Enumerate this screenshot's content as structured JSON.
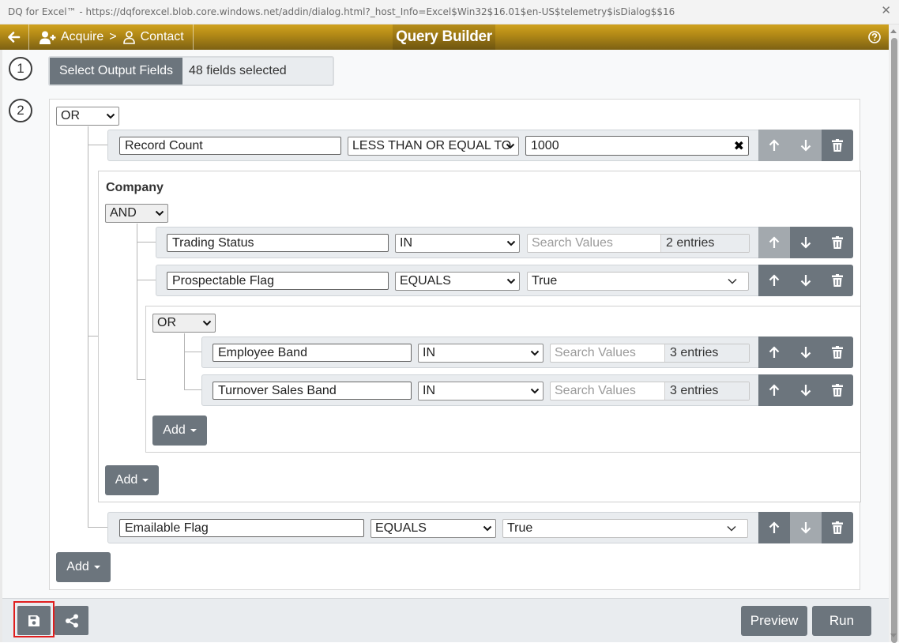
{
  "window": {
    "title": "DQ for Excel™ - https://dqforexcel.blob.core.windows.net/addin/dialog.html?_host_Info=Excel$Win32$16.01$en-US$telemetry$isDialog$$16",
    "close_glyph": "✕"
  },
  "header": {
    "crumb_acquire": "Acquire",
    "crumb_separator": ">",
    "crumb_contact": "Contact",
    "title": "Query Builder"
  },
  "steps": {
    "one": "1",
    "two": "2"
  },
  "output_fields": {
    "button_label": "Select Output Fields",
    "value": "48 fields selected"
  },
  "root": {
    "operator": "OR",
    "rule1": {
      "field": "Record Count",
      "comparator": "LESS THAN OR EQUAL TO",
      "value": "1000",
      "clear_glyph": "✖"
    },
    "company": {
      "label": "Company",
      "operator": "AND",
      "rule1": {
        "field": "Trading Status",
        "comparator": "IN",
        "placeholder": "Search Values",
        "entries": "2 entries"
      },
      "rule2": {
        "field": "Prospectable Flag",
        "comparator": "EQUALS",
        "value": "True"
      },
      "sub": {
        "operator": "OR",
        "rule1": {
          "field": "Employee Band",
          "comparator": "IN",
          "placeholder": "Search Values",
          "entries": "3 entries"
        },
        "rule2": {
          "field": "Turnover Sales Band",
          "comparator": "IN",
          "placeholder": "Search Values",
          "entries": "3 entries"
        },
        "add_label": "Add"
      },
      "add_label": "Add"
    },
    "rule_last": {
      "field": "Emailable Flag",
      "comparator": "EQUALS",
      "value": "True"
    },
    "add_label": "Add"
  },
  "footer": {
    "preview_label": "Preview",
    "run_label": "Run"
  },
  "icons": [
    "arrow-left-icon",
    "user-plus-icon",
    "user-icon",
    "help-circle-icon",
    "arrow-up-icon",
    "arrow-down-icon",
    "trash-icon",
    "save-icon",
    "share-icon",
    "chevron-down-icon"
  ],
  "colors": {
    "header_gold": "#b78d17",
    "button_grey": "#6c757d",
    "highlight_red": "#e01e1e"
  }
}
